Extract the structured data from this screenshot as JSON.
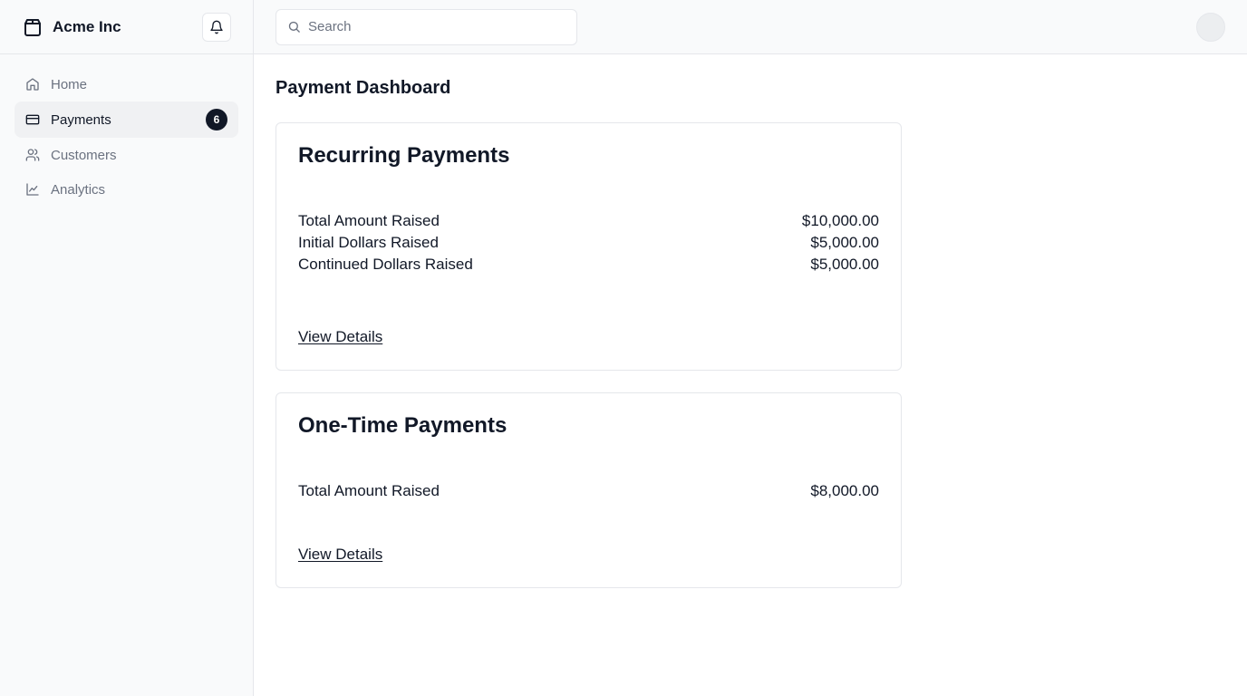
{
  "app": {
    "name": "Acme Inc"
  },
  "sidebar": {
    "items": [
      {
        "label": "Home"
      },
      {
        "label": "Payments",
        "badge": "6"
      },
      {
        "label": "Customers"
      },
      {
        "label": "Analytics"
      }
    ]
  },
  "search": {
    "placeholder": "Search"
  },
  "page": {
    "title": "Payment Dashboard"
  },
  "cards": [
    {
      "title": "Recurring Payments",
      "rows": [
        {
          "label": "Total Amount Raised",
          "value": "$10,000.00"
        },
        {
          "label": "Initial Dollars Raised",
          "value": "$5,000.00"
        },
        {
          "label": "Continued Dollars Raised",
          "value": "$5,000.00"
        }
      ],
      "link": "View Details"
    },
    {
      "title": "One-Time Payments",
      "rows": [
        {
          "label": "Total Amount Raised",
          "value": "$8,000.00"
        }
      ],
      "link": "View Details"
    }
  ]
}
